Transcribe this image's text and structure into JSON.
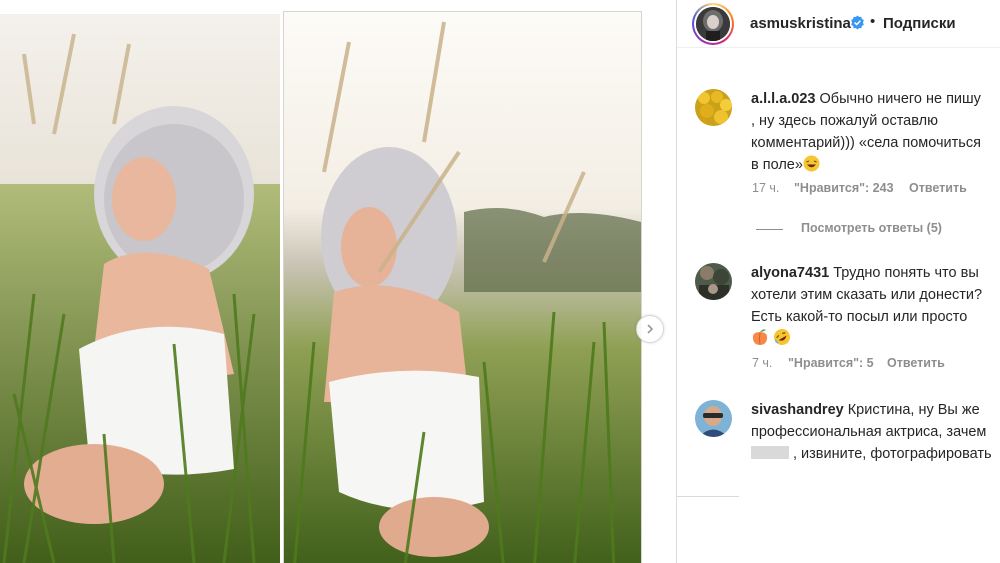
{
  "header": {
    "username": "asmuskristina",
    "separator": "•",
    "follow_label": "Подписки"
  },
  "cut_text": "— — — — —",
  "comments": [
    {
      "username": "a.l.l.a.023",
      "lines": [
        "Обычно ничего не пишу",
        ", ну здесь пожалуй оставлю",
        "комментарий))) «села помочиться",
        "в поле»"
      ],
      "time": "17 ч.",
      "likes": "\"Нравится\": 243",
      "reply": "Ответить",
      "view_replies": "Посмотреть ответы (5)"
    },
    {
      "username": "alyona7431",
      "lines": [
        "Трудно понять что вы",
        "хотели этим сказать или донести?",
        "Есть какой-то посыл или просто"
      ],
      "time": "7 ч.",
      "likes": "\"Нравится\": 5",
      "reply": "Ответить"
    },
    {
      "username": "sivashandrey",
      "lines": [
        "Кристина, ну Вы же",
        "профессиональная актриса, зачем",
        ", извините, фотографировать"
      ]
    }
  ],
  "icons": {
    "verified": "verified-badge-icon",
    "next": "chevron-right-icon",
    "laughing": "laughing-emoji-icon",
    "peach": "peach-emoji-icon",
    "rofl": "rofl-emoji-icon"
  },
  "colors": {
    "verified": "#3897f0",
    "muted": "#8e8e8e",
    "text": "#262626"
  }
}
